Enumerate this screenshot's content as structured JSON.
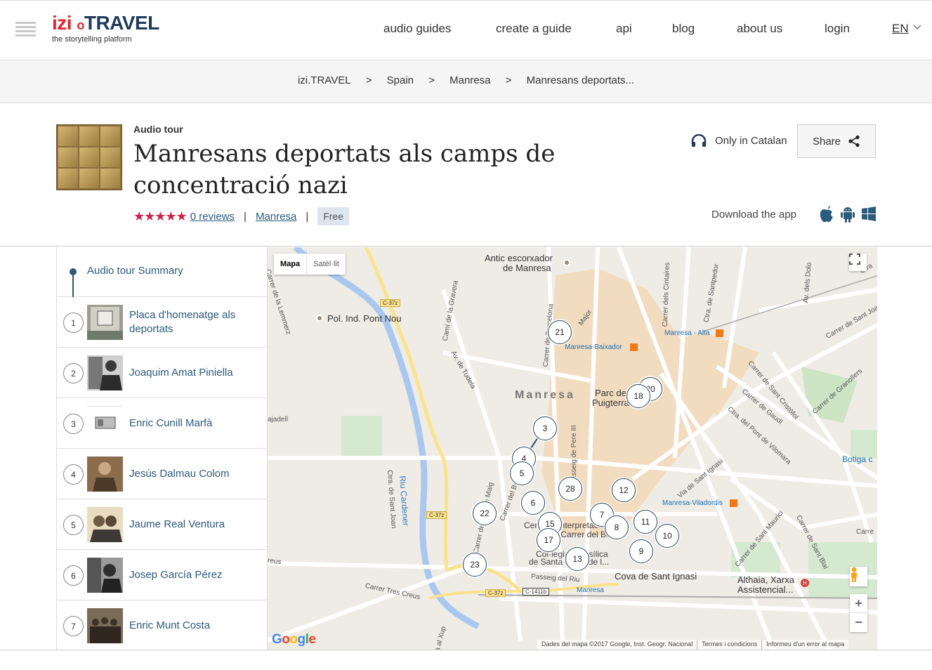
{
  "brand": {
    "izi": "izi",
    "dot": "o",
    "travel": "TRAVEL",
    "tagline": "the storytelling platform"
  },
  "nav": {
    "items": [
      "audio guides",
      "create a guide",
      "api",
      "blog",
      "about us",
      "login"
    ],
    "lang": "EN"
  },
  "breadcrumb": {
    "items": [
      "izi.TRAVEL",
      "Spain",
      "Manresa",
      "Manresans deportats..."
    ],
    "separator": ">"
  },
  "tour": {
    "type": "Audio tour",
    "title": "Manresans deportats als camps de concentració nazi",
    "stars": "★★★★★",
    "reviews": "0 reviews",
    "city": "Manresa",
    "price": "Free",
    "language_note": "Only in Catalan",
    "share_label": "Share",
    "download_label": "Download the app"
  },
  "sidebar": {
    "summary_label": "Audio tour Summary",
    "stops": [
      {
        "num": "1",
        "label": "Placa d'homenatge als deportats"
      },
      {
        "num": "2",
        "label": "Joaquim Amat Piniella"
      },
      {
        "num": "3",
        "label": "Enric Cunill Marfà"
      },
      {
        "num": "4",
        "label": "Jesús Dalmau Colom"
      },
      {
        "num": "5",
        "label": "Jaume Real Ventura"
      },
      {
        "num": "6",
        "label": "Josep García Pérez"
      },
      {
        "num": "7",
        "label": "Enric Munt Costa"
      }
    ]
  },
  "map": {
    "type_map": "Mapa",
    "type_sat": "Satèl·lit",
    "google": "Google",
    "attribution": "Dades del mapa ©2017 Google, Inst. Geogr. Nacional",
    "terms": "Termes i condicions",
    "report": "Informeu d'un error al mapa",
    "markers": [
      "21",
      "20",
      "18",
      "3",
      "4",
      "5",
      "28",
      "12",
      "6",
      "22",
      "7",
      "15",
      "8",
      "11",
      "17",
      "10",
      "9",
      "13",
      "23"
    ],
    "labels": {
      "manresa": "Manresa",
      "antic": "Antic escorxador",
      "antic2": "de Manresa",
      "pol": "Pol. Ind. Pont Nou",
      "parc": "Parc de",
      "parc2": "Puigterra",
      "baixador": "Manresa-Baixador",
      "alta": "Manresa - Alta",
      "viladordis": "Manresa-Viladordis",
      "cova": "Cova de Sant Ignasi",
      "althaia": "Althaia, Xarxa",
      "althaia2": "Assistencial...",
      "botiga": "Botiga c",
      "riu": "Riu Cardener",
      "basilica": "Col·legiata Basílica",
      "santa": "de Santa Maria de l...",
      "interpret": "Centre d'Interpretació",
      "carrer_balls": "del Carrer del Balç",
      "manresa_station": "Manresa",
      "tres_creus": "Carrer Tres Creus",
      "passeig_riu": "Passeig del Riu",
      "xup": "Carretera al Xup",
      "lemmerz": "Carrer de la Lemmerz",
      "tudela": "Av. de Tudela",
      "gravera": "Camí de la Gravera",
      "barcelona": "Carrer de Barcelona",
      "pere": "Passeig de Pere III",
      "maig": "Carrer del Dos de Maig",
      "bruc": "Carrer del Bruc",
      "sant_joan": "Ctra. de Sant Joan",
      "cintaires": "Carrer dels Cintaires",
      "santpedor": "Ctra. de Santpedor",
      "gaudi": "Carrer de Gaudí",
      "vilomara": "Ctra. del Pont de Vilomara",
      "cristofol": "Carrer de Sant Cristòfol",
      "granollers": "Carrer de Granollers",
      "sant_ignasi": "Via de Sant Ignasi",
      "sant_mauric": "Carrer de Sant Maurici",
      "sant_blai": "Carrer de Sant Blai",
      "sant_joan2": "Carrer de Sant Joan",
      "dels_dolo": "Av. dels Dolo",
      "major": "Major",
      "jadell": "ajadell",
      "reus": "reus",
      "ctra": "Ctra",
      "carre": "Carre",
      "c37z_a": "C-37z",
      "c37z_b": "C-37z",
      "c37z_c": "C-37z",
      "c1411b": "C-1411b"
    }
  },
  "colors": {
    "accent": "#2b5a7a",
    "star": "#cc1f4c",
    "brand_red": "#e2242c",
    "brand_navy": "#1f3b5a"
  }
}
